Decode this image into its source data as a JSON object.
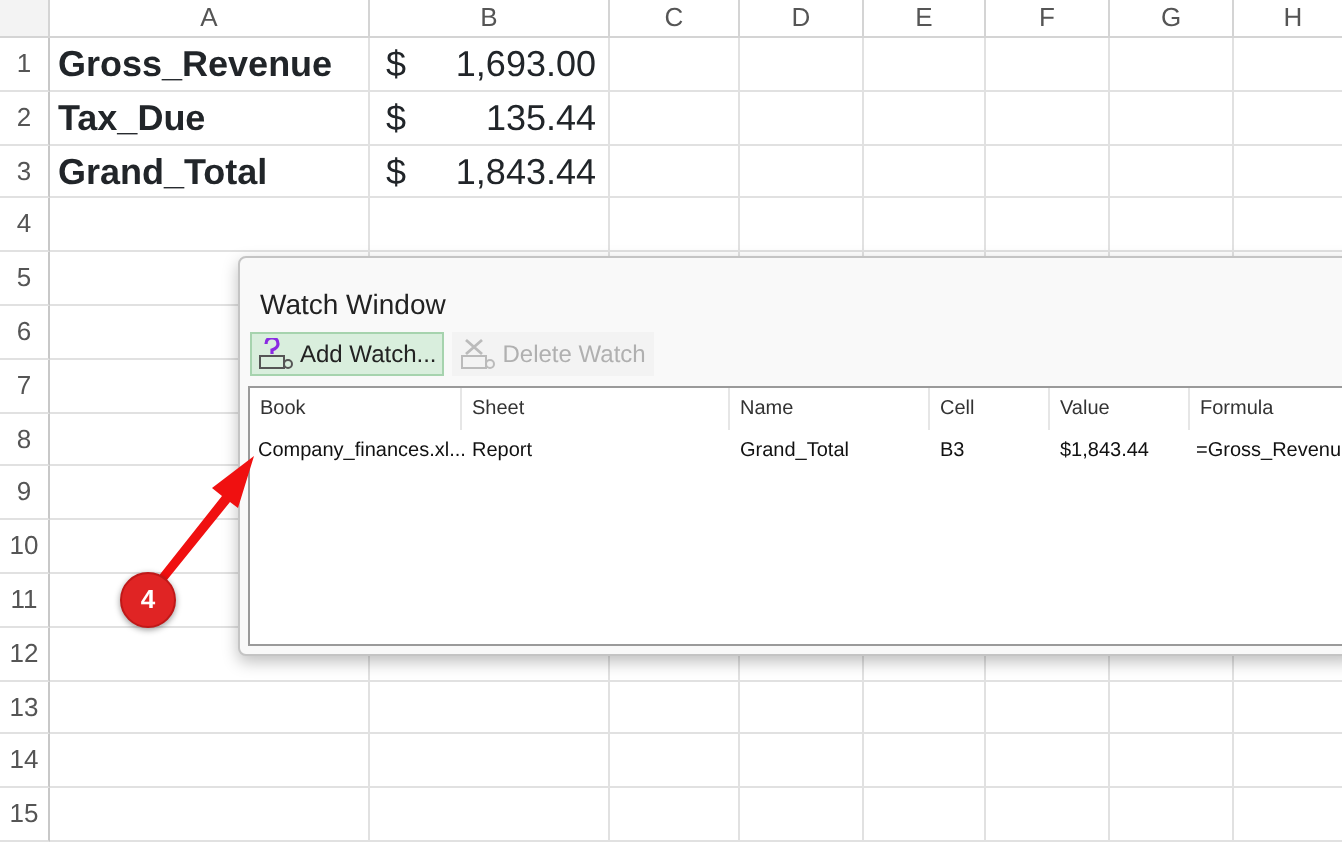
{
  "sheet": {
    "columns": [
      "A",
      "B",
      "C",
      "D",
      "E",
      "F",
      "G",
      "H"
    ],
    "rows": [
      {
        "number": "1",
        "label": "Gross_Revenue",
        "currency": "$",
        "amount": "1,693.00"
      },
      {
        "number": "2",
        "label": "Tax_Due",
        "currency": "$",
        "amount": "135.44"
      },
      {
        "number": "3",
        "label": "Grand_Total",
        "currency": "$",
        "amount": "1,843.44"
      },
      {
        "number": "4"
      },
      {
        "number": "5"
      },
      {
        "number": "6"
      },
      {
        "number": "7"
      },
      {
        "number": "8"
      },
      {
        "number": "9"
      },
      {
        "number": "10"
      },
      {
        "number": "11"
      },
      {
        "number": "12"
      },
      {
        "number": "13"
      },
      {
        "number": "14"
      },
      {
        "number": "15"
      }
    ]
  },
  "watch_window": {
    "title": "Watch Window",
    "toolbar": [
      {
        "kind": "add",
        "label": "Add Watch...",
        "disabled": false,
        "selected": true
      },
      {
        "kind": "delete",
        "label": "Delete Watch",
        "disabled": true,
        "selected": false
      }
    ],
    "columns": [
      "Book",
      "Sheet",
      "Name",
      "Cell",
      "Value",
      "Formula"
    ],
    "rows": [
      [
        "Company_finances.xl...",
        "Report",
        "Grand_Total",
        "B3",
        "$1,843.44",
        "=Gross_Revenu"
      ]
    ]
  },
  "callout": {
    "number": "4"
  }
}
